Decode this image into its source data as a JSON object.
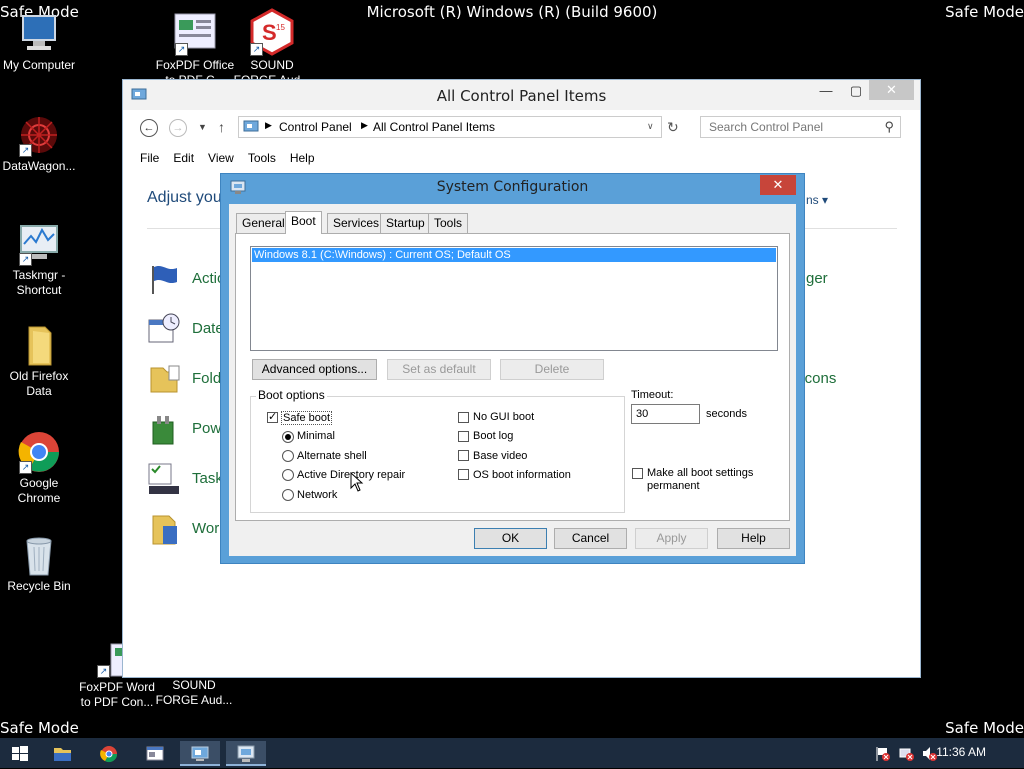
{
  "desktop": {
    "safe_mode_tl": "Safe Mode",
    "safe_mode_tr": "Safe Mode",
    "safe_mode_bl": "Safe Mode",
    "safe_mode_br": "Safe Mode",
    "build": "Microsoft (R) Windows (R) (Build 9600)",
    "icons": [
      {
        "line1": "My Computer",
        "line2": ""
      },
      {
        "line1": "DataWagon...",
        "line2": ""
      },
      {
        "line1": "Taskmgr -",
        "line2": "Shortcut"
      },
      {
        "line1": "Old Firefox",
        "line2": "Data"
      },
      {
        "line1": "Google",
        "line2": "Chrome"
      },
      {
        "line1": "Recycle Bin",
        "line2": ""
      },
      {
        "line1": "FoxPDF Office",
        "line2": "to PDF C..."
      },
      {
        "line1": "SOUND",
        "line2": "FORGE Aud..."
      },
      {
        "line1": "FoxPDF Word",
        "line2": "to PDF Con..."
      },
      {
        "line1": "SOUND",
        "line2": "FORGE Aud..."
      }
    ]
  },
  "control_panel": {
    "title": "All Control Panel Items",
    "breadcrumb": [
      "Control Panel",
      "All Control Panel Items"
    ],
    "search_placeholder": "Search Control Panel",
    "menu": [
      "File",
      "Edit",
      "View",
      "Tools",
      "Help"
    ],
    "heading_partial": "Adjust you",
    "view_partial": "ns",
    "items_left": [
      "Actio",
      "Date",
      "Fold",
      "Pow",
      "Task",
      "Wor"
    ],
    "items_right": [
      "ger",
      "a Icons"
    ]
  },
  "sysconfig": {
    "title": "System Configuration",
    "tabs": [
      "General",
      "Boot",
      "Services",
      "Startup",
      "Tools"
    ],
    "os_entry": "Windows 8.1 (C:\\Windows) : Current OS; Default OS",
    "btn_advanced": "Advanced options...",
    "btn_set_default": "Set as default",
    "btn_delete": "Delete",
    "boot_options_label": "Boot options",
    "safe_boot": "Safe boot",
    "minimal": "Minimal",
    "alternate_shell": "Alternate shell",
    "active_directory_repair": "Active Directory repair",
    "network": "Network",
    "no_gui_boot": "No GUI boot",
    "boot_log": "Boot log",
    "base_video": "Base video",
    "os_boot_information": "OS boot information",
    "timeout_label": "Timeout:",
    "timeout_value": "30",
    "seconds": "seconds",
    "make_permanent_1": "Make all boot settings",
    "make_permanent_2": "permanent",
    "ok": "OK",
    "cancel": "Cancel",
    "apply": "Apply",
    "help": "Help"
  },
  "taskbar": {
    "time": "11:36 AM"
  }
}
